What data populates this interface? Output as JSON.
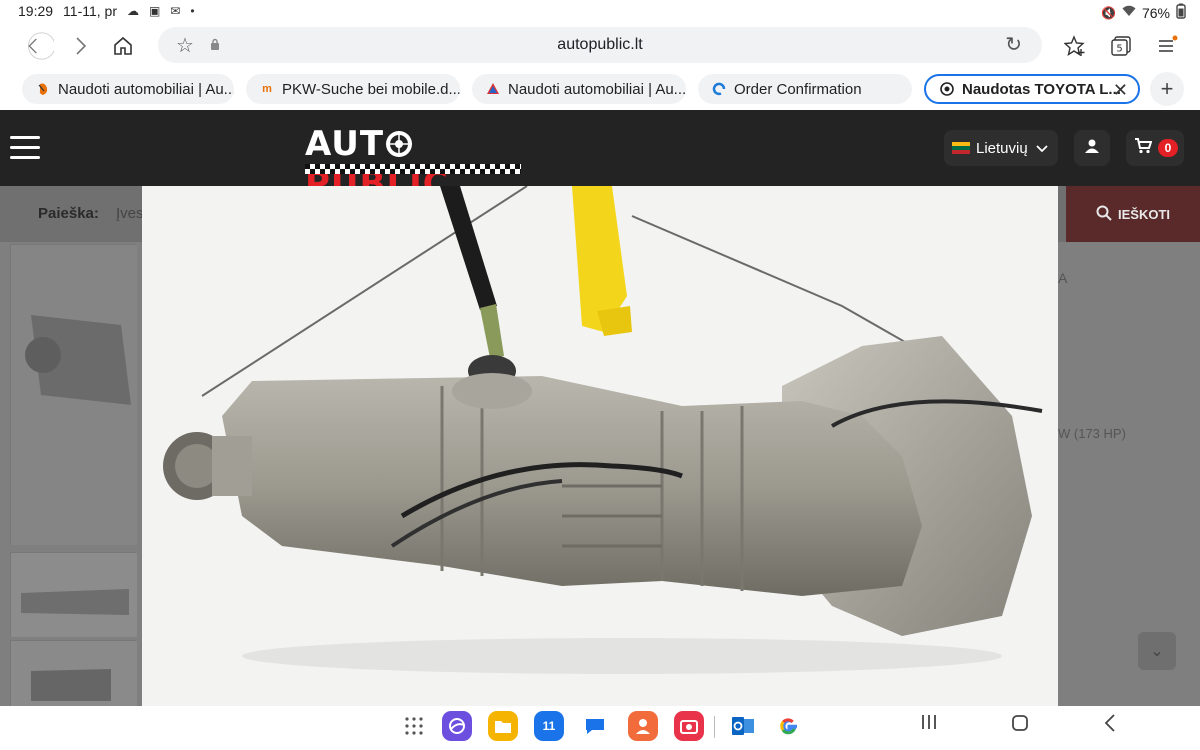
{
  "status_bar": {
    "time": "19:29",
    "date": "11-11, pr",
    "battery": "76%"
  },
  "browser": {
    "url": "autopublic.lt",
    "tabs": [
      {
        "label": "Naudoti automobiliai | Au...",
        "icon": "autopublic-favicon"
      },
      {
        "label": "PKW-Suche bei mobile.d...",
        "icon": "mobile-de-favicon"
      },
      {
        "label": "Naudoti automobiliai | Au...",
        "icon": "autoplius-favicon"
      },
      {
        "label": "Order Confirmation",
        "icon": "edge-favicon"
      },
      {
        "label": "Naudotas TOYOTA L...",
        "icon": "autopublic-favicon",
        "active": true
      }
    ]
  },
  "site": {
    "logo_part1": "AUT",
    "logo_part2": "PUBLIC",
    "language": "Lietuvių",
    "cart_count": "0",
    "search_label": "Paieška:",
    "search_placeholder": "Įves",
    "search_button": "IEŠKOTI",
    "side_text_1": "A",
    "side_text_2": "W (173 HP)"
  },
  "colors": {
    "header_bg": "#232323",
    "brand_red": "#e32025",
    "active_tab_border": "#1a73e8"
  },
  "taskbar_apps": [
    "apps-grid-icon",
    "internet-icon",
    "files-icon",
    "calendar-icon",
    "messages-icon",
    "contacts-icon",
    "camera-icon",
    "outlook-icon",
    "google-icon"
  ]
}
